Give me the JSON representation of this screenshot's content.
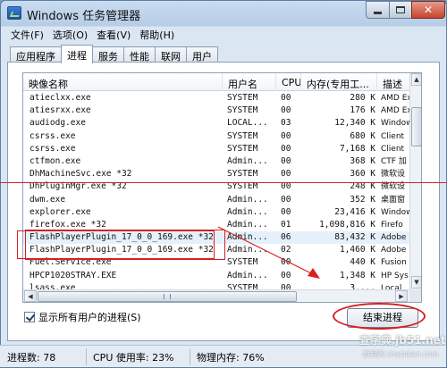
{
  "window": {
    "title": "Windows 任务管理器",
    "buttons": {
      "minimize": "",
      "maximize": "",
      "close": "✕"
    }
  },
  "menu": [
    "文件(F)",
    "选项(O)",
    "查看(V)",
    "帮助(H)"
  ],
  "tabs": [
    "应用程序",
    "进程",
    "服务",
    "性能",
    "联网",
    "用户"
  ],
  "active_tab": "进程",
  "columns": [
    "映像名称",
    "用户名",
    "CPU",
    "内存(专用工...",
    "描述"
  ],
  "processes": [
    {
      "name": "atieclxx.exe",
      "user": "SYSTEM",
      "cpu": "00",
      "mem": "280 K",
      "desc": "AMD Ex"
    },
    {
      "name": "atiesrxx.exe",
      "user": "SYSTEM",
      "cpu": "00",
      "mem": "176 K",
      "desc": "AMD Ex"
    },
    {
      "name": "audiodg.exe",
      "user": "LOCAL...",
      "cpu": "03",
      "mem": "12,340 K",
      "desc": "Window"
    },
    {
      "name": "csrss.exe",
      "user": "SYSTEM",
      "cpu": "00",
      "mem": "680 K",
      "desc": "Client"
    },
    {
      "name": "csrss.exe",
      "user": "SYSTEM",
      "cpu": "00",
      "mem": "7,168 K",
      "desc": "Client"
    },
    {
      "name": "ctfmon.exe",
      "user": "Admin...",
      "cpu": "00",
      "mem": "368 K",
      "desc": "CTF 加"
    },
    {
      "name": "DhMachineSvc.exe *32",
      "user": "SYSTEM",
      "cpu": "00",
      "mem": "360 K",
      "desc": "微软设"
    },
    {
      "name": "DhPluginMgr.exe *32",
      "user": "SYSTEM",
      "cpu": "00",
      "mem": "248 K",
      "desc": "微软设"
    },
    {
      "name": "dwm.exe",
      "user": "Admin...",
      "cpu": "00",
      "mem": "352 K",
      "desc": "桌面窗"
    },
    {
      "name": "explorer.exe",
      "user": "Admin...",
      "cpu": "00",
      "mem": "23,416 K",
      "desc": "Window"
    },
    {
      "name": "firefox.exe *32",
      "user": "Admin...",
      "cpu": "01",
      "mem": "1,098,816 K",
      "desc": "Firefo"
    },
    {
      "name": "FlashPlayerPlugin_17_0_0_169.exe *32",
      "user": "Admin...",
      "cpu": "06",
      "mem": "83,432 K",
      "desc": "Adobe"
    },
    {
      "name": "FlashPlayerPlugin_17_0_0_169.exe *32",
      "user": "Admin...",
      "cpu": "02",
      "mem": "1,460 K",
      "desc": "Adobe"
    },
    {
      "name": "Fuel.Service.exe",
      "user": "SYSTEM",
      "cpu": "00",
      "mem": "440 K",
      "desc": "Fusion"
    },
    {
      "name": "HPCP1020STRAY.EXE",
      "user": "Admin...",
      "cpu": "00",
      "mem": "1,348 K",
      "desc": "HP Sys"
    },
    {
      "name": "lsass.exe",
      "user": "SYSTEM",
      "cpu": "00",
      "mem": "3,...",
      "desc": "Local"
    }
  ],
  "show_all_users": {
    "label": "显示所有用户的进程(S)",
    "checked": true
  },
  "end_process_label": "结束进程",
  "status": {
    "processes": "进程数: 78",
    "cpu": "CPU 使用率: 23%",
    "memory": "物理内存: 76%"
  },
  "watermark": {
    "line1": "查字典 jb51.net",
    "line2": "教程网 chazidian.com"
  },
  "colors": {
    "annotation": "#d62020",
    "titlebar": "#b7cde6",
    "selection": "#e6f0fb"
  }
}
